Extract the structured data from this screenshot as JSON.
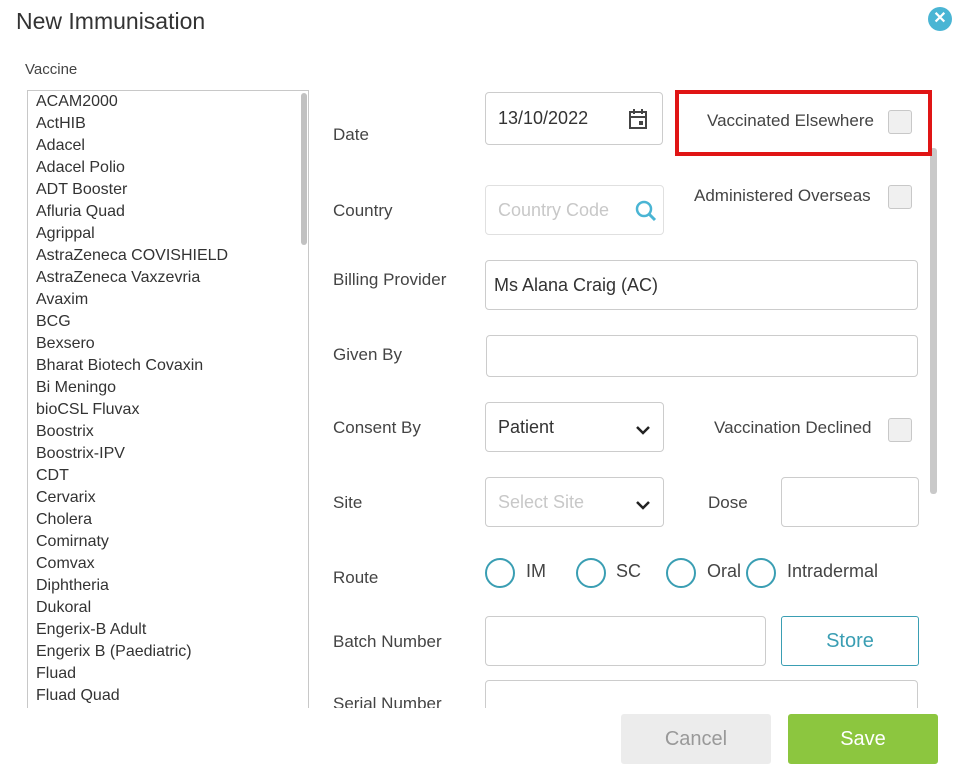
{
  "dialog": {
    "title": "New Immunisation",
    "close_icon": "close-icon"
  },
  "vaccine": {
    "label": "Vaccine",
    "items": [
      "ACAM2000",
      "ActHIB",
      "Adacel",
      "Adacel Polio",
      "ADT Booster",
      "Afluria Quad",
      "Agrippal",
      "AstraZeneca COVISHIELD",
      "AstraZeneca Vaxzevria",
      "Avaxim",
      "BCG",
      "Bexsero",
      "Bharat Biotech Covaxin",
      "Bi Meningo",
      "bioCSL Fluvax",
      "Boostrix",
      "Boostrix-IPV",
      "CDT",
      "Cervarix",
      "Cholera",
      "Comirnaty",
      "Comvax",
      "Diphtheria",
      "Dukoral",
      "Engerix-B Adult",
      "Engerix B (Paediatric)",
      "Fluad",
      "Fluad Quad"
    ]
  },
  "form": {
    "date": {
      "label": "Date",
      "value": "13/10/2022",
      "icon": "calendar-icon"
    },
    "vaccinated_elsewhere": {
      "label": "Vaccinated Elsewhere",
      "checked": false
    },
    "country": {
      "label": "Country",
      "placeholder": "Country Code",
      "icon": "search-icon"
    },
    "administered_overseas": {
      "label": "Administered Overseas",
      "checked": false
    },
    "billing_provider": {
      "label": "Billing Provider",
      "value": "Ms Alana Craig (AC)"
    },
    "given_by": {
      "label": "Given By",
      "value": ""
    },
    "consent_by": {
      "label": "Consent By",
      "value": "Patient"
    },
    "vaccination_declined": {
      "label": "Vaccination Declined",
      "checked": false
    },
    "site": {
      "label": "Site",
      "placeholder": "Select Site"
    },
    "dose": {
      "label": "Dose",
      "value": ""
    },
    "route": {
      "label": "Route",
      "options": [
        "IM",
        "SC",
        "Oral",
        "Intradermal"
      ]
    },
    "batch_number": {
      "label": "Batch Number",
      "value": "",
      "store_label": "Store"
    },
    "serial_number": {
      "label": "Serial Number",
      "value": ""
    }
  },
  "footer": {
    "cancel_label": "Cancel",
    "save_label": "Save"
  },
  "colors": {
    "accent": "#3a9eb3",
    "save": "#8cc63f",
    "highlight": "#e01515",
    "close": "#4ab5d4"
  }
}
